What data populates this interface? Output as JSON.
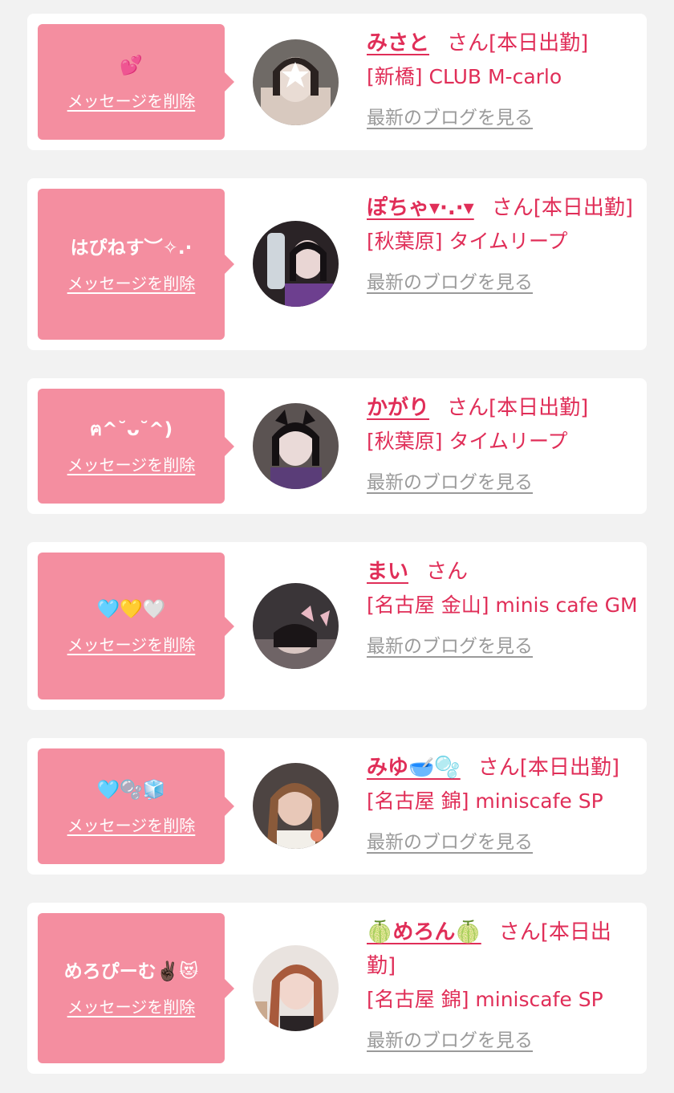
{
  "favorites": [
    {
      "message": "💕",
      "delete_label": "メッセージを削除",
      "name": "みさと",
      "san": "さん",
      "status": "[本日出勤]",
      "shop": "[新橋] CLUB M-carlo",
      "blog_label": "最新のブログを見る",
      "avatar_colors": [
        "#6f6a66",
        "#d8c9bf",
        "#2a2220"
      ]
    },
    {
      "message": "はぴねす︶✧.·",
      "delete_label": "メッセージを削除",
      "name": "ぽちゃ▾·.·▾",
      "san": "さん",
      "status": "[本日出勤]",
      "shop": "[秋葉原] タイムリープ",
      "blog_label": "最新のブログを見る",
      "avatar_colors": [
        "#2a2326",
        "#e9d6d4",
        "#6d3f8f"
      ]
    },
    {
      "message": "ฅ^˘ᴗ˘^)",
      "delete_label": "メッセージを削除",
      "name": "かがり",
      "san": "さん",
      "status": "[本日出勤]",
      "shop": "[秋葉原] タイムリープ",
      "blog_label": "最新のブログを見る",
      "avatar_colors": [
        "#5b5352",
        "#eadad8",
        "#5a3d78"
      ]
    },
    {
      "message": "🩵💛🤍",
      "delete_label": "メッセージを削除",
      "name": "まい",
      "san": "さん",
      "status": "",
      "shop": "[名古屋 金山] minis cafe GM",
      "blog_label": "最新のブログを見る",
      "avatar_colors": [
        "#3a3538",
        "#e9b9c4",
        "#6f6466"
      ]
    },
    {
      "message": "🩵🫧🧊",
      "delete_label": "メッセージを削除",
      "name": "みゆ🥣🫧",
      "san": "さん",
      "status": "[本日出勤]",
      "shop": "[名古屋 錦] miniscafe SP",
      "blog_label": "最新のブログを見る",
      "avatar_colors": [
        "#4d4442",
        "#e8c8b8",
        "#8a5a3a"
      ]
    },
    {
      "message": "めろぴーむ✌🏿😻",
      "delete_label": "メッセージを削除",
      "name": "🍈めろん🍈",
      "san": "さん",
      "status": "[本日出勤]",
      "shop": "[名古屋 錦] miniscafe SP",
      "blog_label": "最新のブログを見る",
      "avatar_colors": [
        "#e9e3df",
        "#f1d6cc",
        "#a85a3c"
      ]
    }
  ]
}
